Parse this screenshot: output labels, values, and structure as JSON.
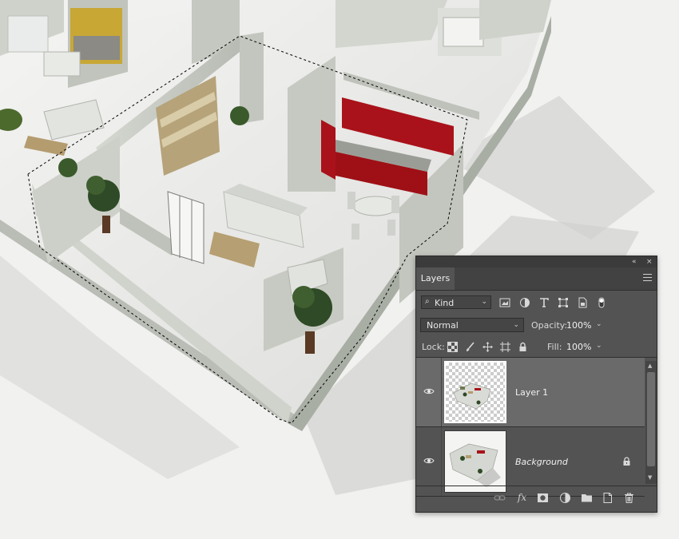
{
  "panel": {
    "tab_label": "Layers",
    "collapse_glyph": "«",
    "close_glyph": "×",
    "filter": {
      "kind_label": "Kind",
      "search_glyph": "⌕",
      "chevron": "⌄",
      "icons": [
        "pixel-filter-icon",
        "adjustment-filter-icon",
        "type-filter-icon",
        "shape-filter-icon",
        "smart-object-filter-icon",
        "filter-toggle-icon"
      ]
    },
    "blend": {
      "mode": "Normal",
      "opacity_label": "Opacity:",
      "opacity_value": "100%",
      "chevron": "⌄"
    },
    "lock": {
      "label": "Lock:",
      "icons": [
        "lock-transparent-icon",
        "lock-image-icon",
        "lock-position-icon",
        "lock-artboard-icon",
        "lock-all-icon"
      ],
      "fill_label": "Fill:",
      "fill_value": "100%",
      "chevron": "⌄"
    },
    "layers": [
      {
        "name": "Layer 1",
        "selected": true,
        "visible": true,
        "locked": false
      },
      {
        "name": "Background",
        "selected": false,
        "visible": true,
        "locked": true
      }
    ],
    "scroll": {
      "up_glyph": "▲",
      "down_glyph": "▼"
    },
    "bottom_icons": [
      "link-layers-icon",
      "layer-effects-icon",
      "layer-mask-icon",
      "adjustment-layer-icon",
      "new-group-icon",
      "new-layer-icon",
      "delete-layer-icon"
    ],
    "fx_label": "fx"
  },
  "colors": {
    "panel_bg": "#535353",
    "selected_row": "#6a6a6a",
    "cabinet_red": "#a9121a",
    "wall": "#c9ccc5",
    "floor": "#e8e8e6",
    "plant": "#2f4a26"
  }
}
